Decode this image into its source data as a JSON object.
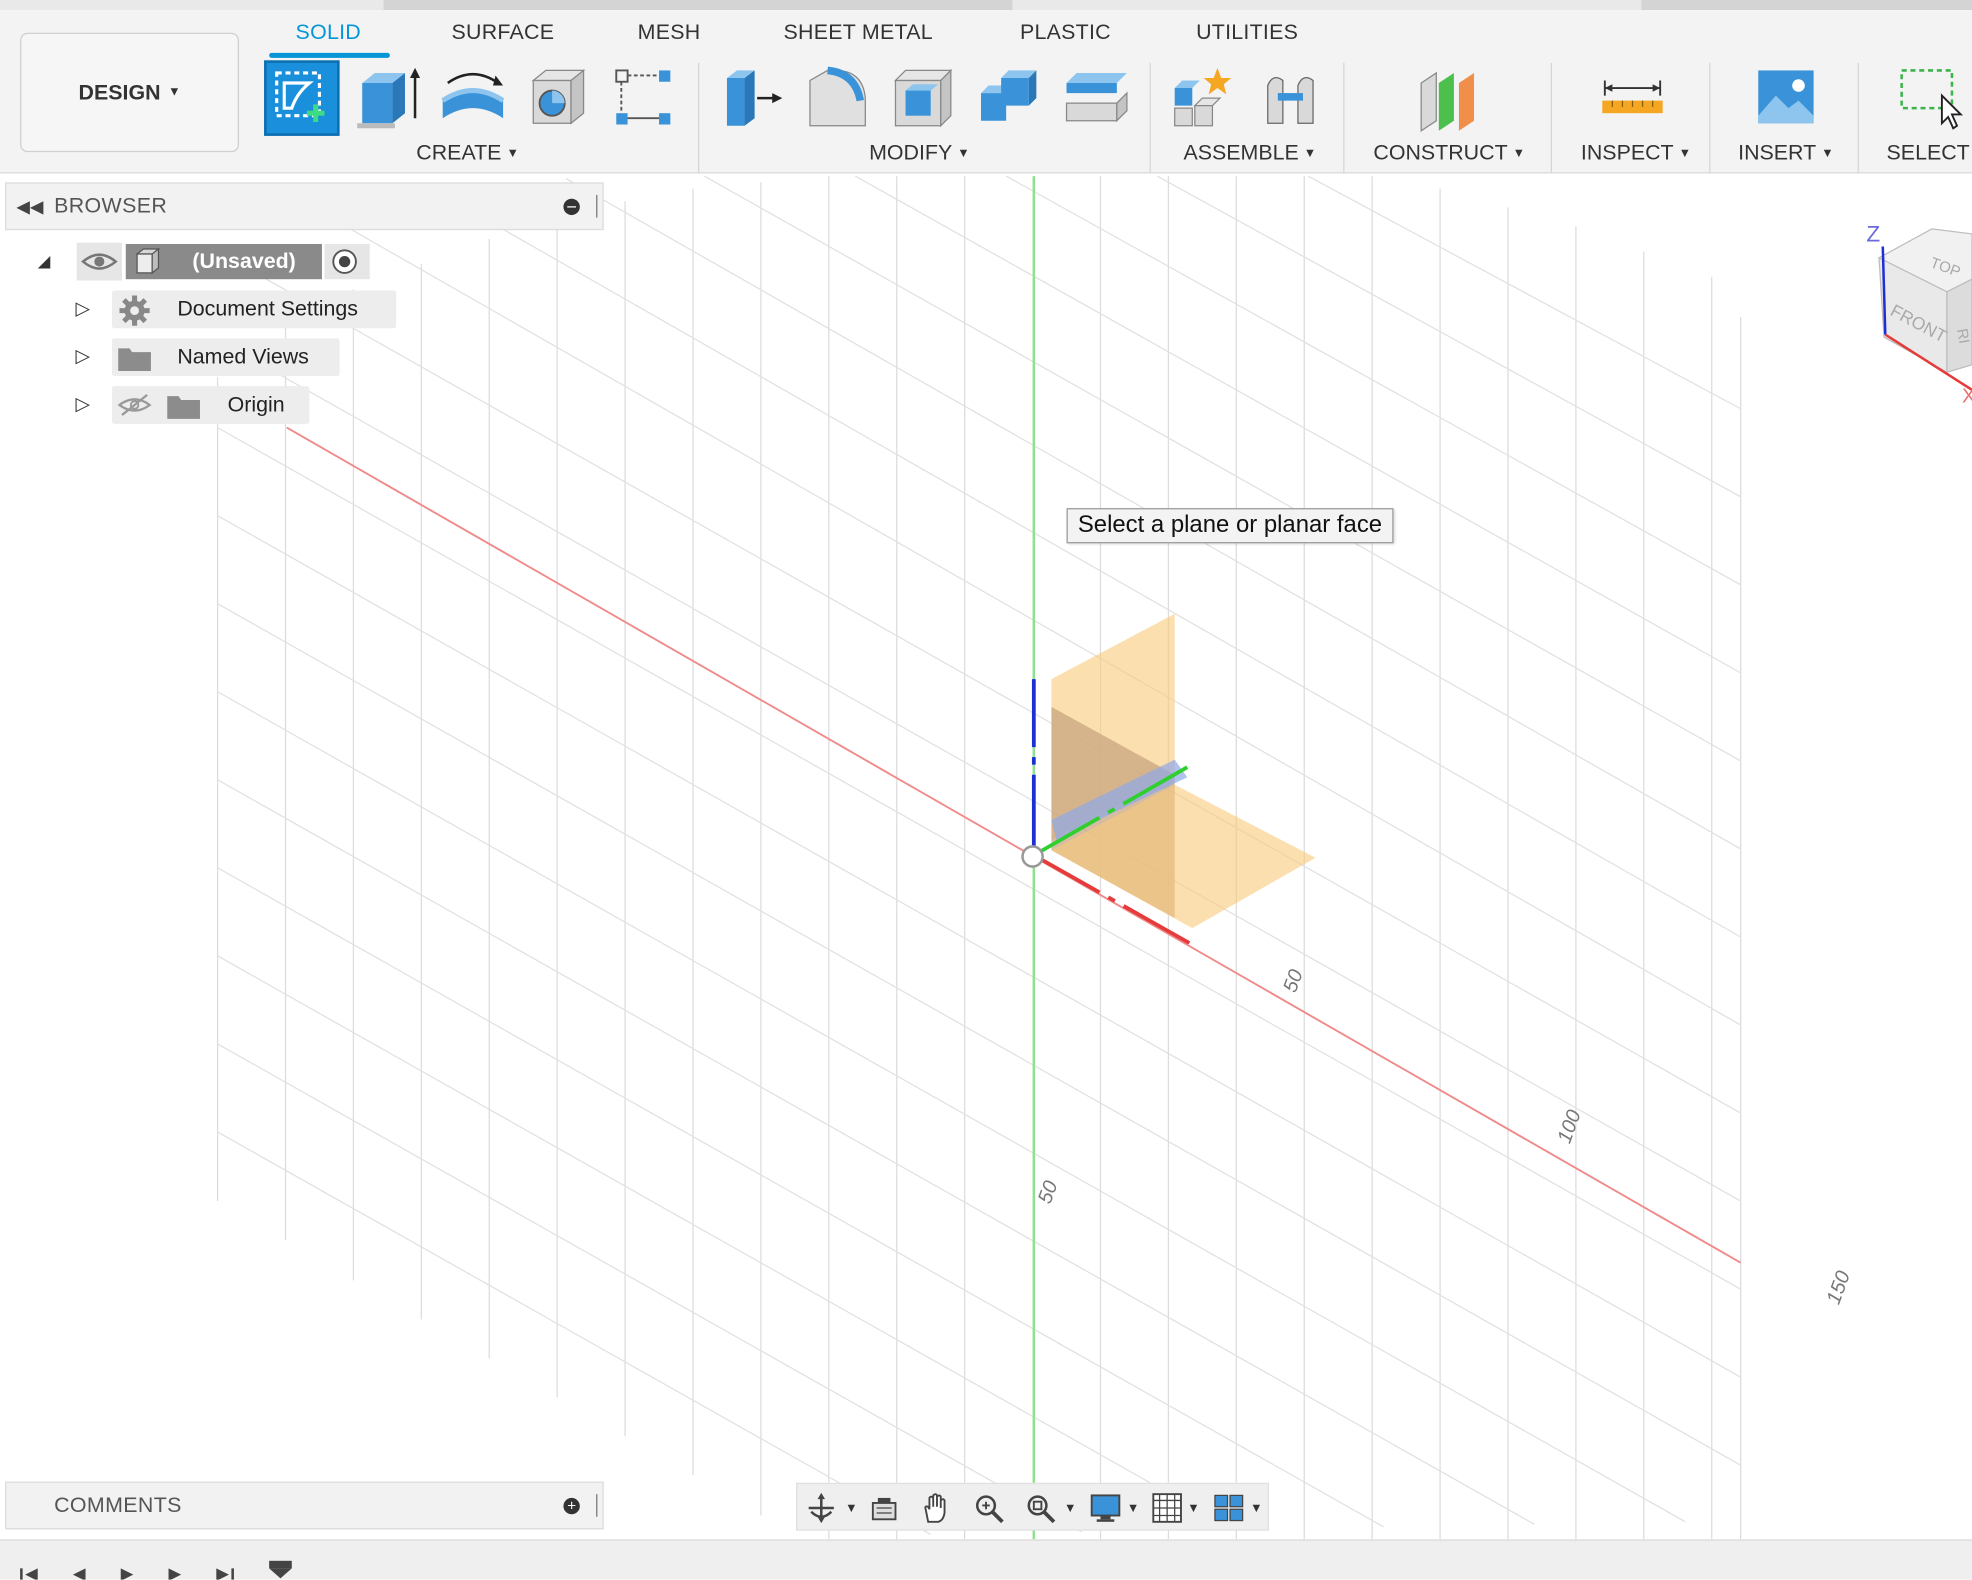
{
  "workspace": {
    "label": "DESIGN"
  },
  "tabs": [
    {
      "label": "SOLID",
      "active": true
    },
    {
      "label": "SURFACE",
      "active": false
    },
    {
      "label": "MESH",
      "active": false
    },
    {
      "label": "SHEET METAL",
      "active": false
    },
    {
      "label": "PLASTIC",
      "active": false
    },
    {
      "label": "UTILITIES",
      "active": false
    }
  ],
  "groups": {
    "create": "CREATE",
    "modify": "MODIFY",
    "assemble": "ASSEMBLE",
    "construct": "CONSTRUCT",
    "inspect": "INSPECT",
    "insert": "INSERT",
    "select": "SELECT"
  },
  "browser": {
    "title": "BROWSER",
    "root": "(Unsaved)",
    "items": [
      {
        "label": "Document Settings",
        "icon": "gear-icon"
      },
      {
        "label": "Named Views",
        "icon": "folder-icon"
      },
      {
        "label": "Origin",
        "icon": "folder-icon",
        "hidden": true
      }
    ]
  },
  "comments": {
    "title": "COMMENTS"
  },
  "viewport": {
    "tooltip": "Select a plane or planar face",
    "grid_labels": [
      "50",
      "100",
      "150",
      "50"
    ]
  },
  "viewcube": {
    "faces": [
      "TOP",
      "FRONT",
      "RI"
    ],
    "axes": [
      "Z",
      "X"
    ]
  },
  "colors": {
    "accent": "#0696d7",
    "x_axis": "#e53b3b",
    "y_axis": "#2fcf2f",
    "z_axis": "#1f2fd6",
    "plane_fill": "#f9c97a"
  }
}
